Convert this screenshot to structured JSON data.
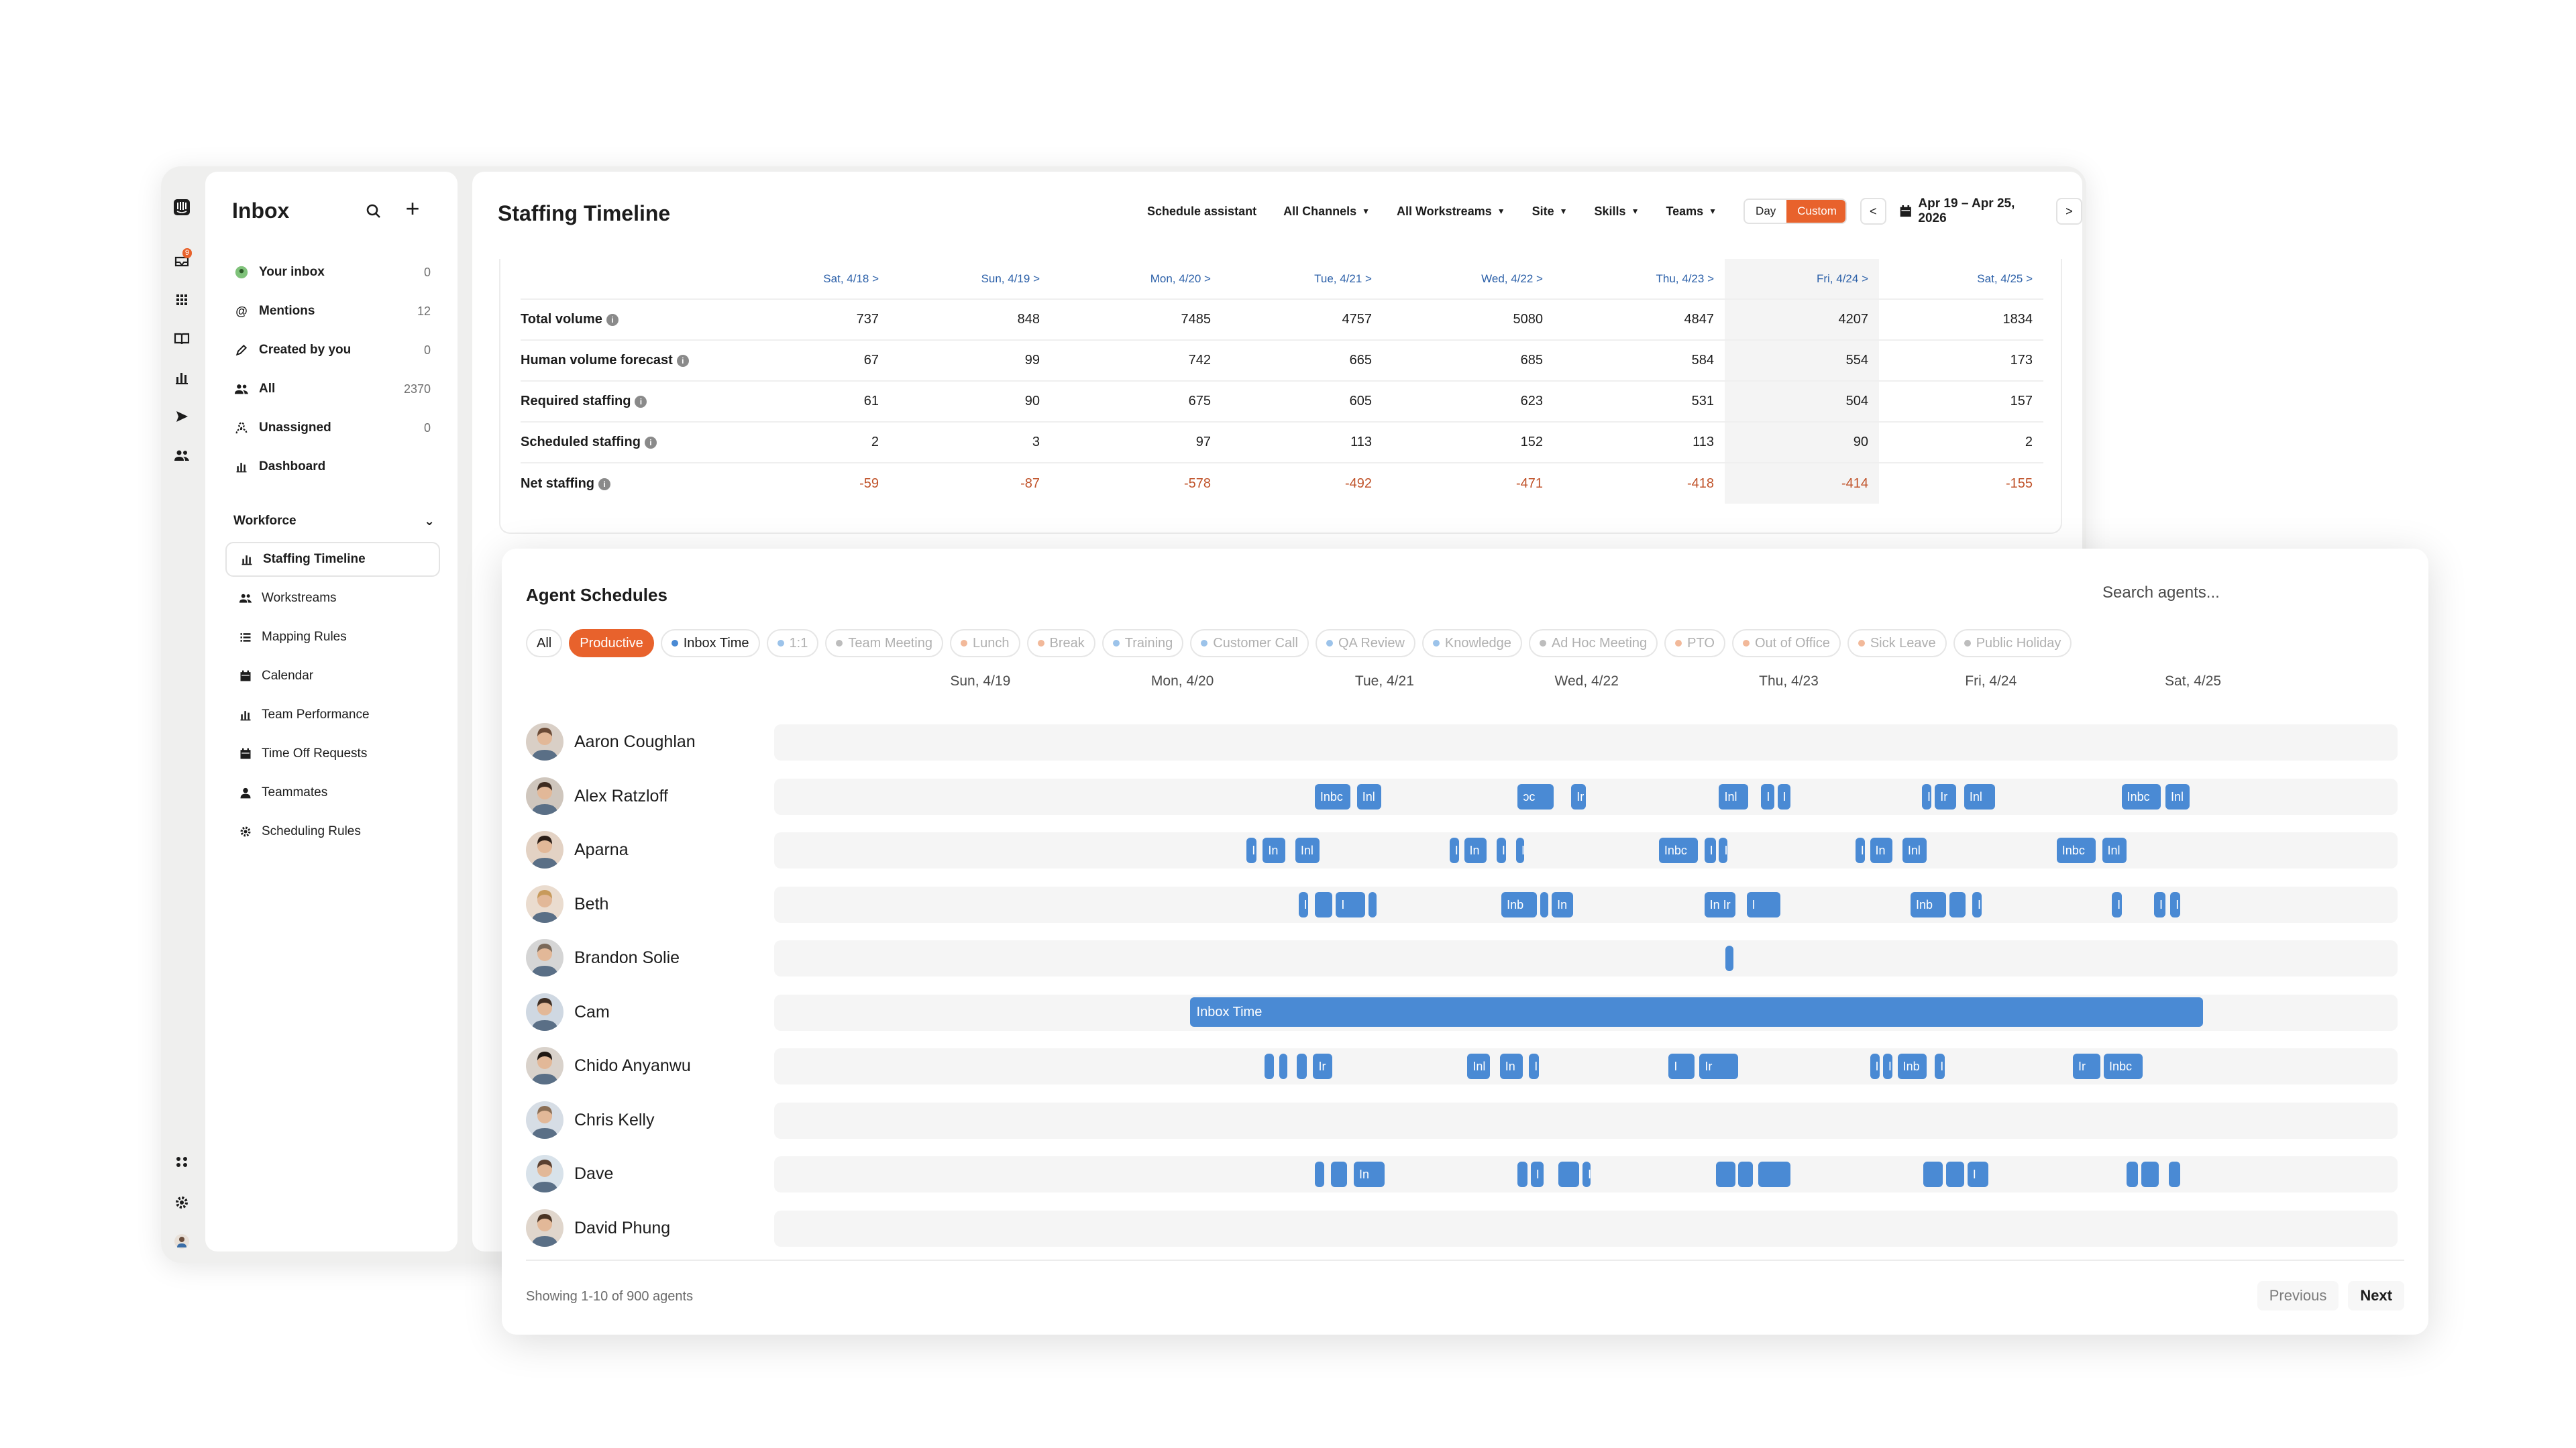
{
  "sidebar": {
    "title": "Inbox",
    "badge": "9",
    "items": [
      {
        "label": "Your inbox",
        "count": "0",
        "icon": "avatar-dot-icon"
      },
      {
        "label": "Mentions",
        "count": "12",
        "icon": "at-icon"
      },
      {
        "label": "Created by you",
        "count": "0",
        "icon": "pencil-icon"
      },
      {
        "label": "All",
        "count": "2370",
        "icon": "people-icon"
      },
      {
        "label": "Unassigned",
        "count": "0",
        "icon": "unassigned-icon"
      },
      {
        "label": "Dashboard",
        "count": "",
        "icon": "bar-chart-icon"
      }
    ],
    "section": "Workforce",
    "workforce": [
      {
        "label": "Staffing Timeline",
        "icon": "bar-chart-icon"
      },
      {
        "label": "Workstreams",
        "icon": "people-icon"
      },
      {
        "label": "Mapping Rules",
        "icon": "list-icon"
      },
      {
        "label": "Calendar",
        "icon": "calendar-icon"
      },
      {
        "label": "Team Performance",
        "icon": "bar-chart-icon"
      },
      {
        "label": "Time Off Requests",
        "icon": "calendar-icon"
      },
      {
        "label": "Teammates",
        "icon": "person-icon"
      },
      {
        "label": "Scheduling Rules",
        "icon": "gear-icon"
      }
    ]
  },
  "header": {
    "title": "Staffing Timeline",
    "schedule_assistant": "Schedule assistant",
    "channels": "All Channels",
    "workstreams": "All Workstreams",
    "site": "Site",
    "skills": "Skills",
    "teams": "Teams",
    "day": "Day",
    "custom": "Custom",
    "prev": "<",
    "next": ">",
    "date_range": "Apr 19 – Apr 25, 2026"
  },
  "metrics": {
    "columns": [
      "Sat, 4/18 >",
      "Sun, 4/19 >",
      "Mon, 4/20 >",
      "Tue, 4/21 >",
      "Wed, 4/22 >",
      "Thu, 4/23 >",
      "Fri, 4/24 >",
      "Sat, 4/25 >"
    ],
    "rows": [
      {
        "label": "Total volume",
        "values": [
          "737",
          "848",
          "7485",
          "4757",
          "5080",
          "4847",
          "4207",
          "1834"
        ]
      },
      {
        "label": "Human volume forecast",
        "values": [
          "67",
          "99",
          "742",
          "665",
          "685",
          "584",
          "554",
          "173"
        ]
      },
      {
        "label": "Required staffing",
        "values": [
          "61",
          "90",
          "675",
          "605",
          "623",
          "531",
          "504",
          "157"
        ]
      },
      {
        "label": "Scheduled staffing",
        "values": [
          "2",
          "3",
          "97",
          "113",
          "152",
          "113",
          "90",
          "2"
        ]
      },
      {
        "label": "Net staffing",
        "values": [
          "-59",
          "-87",
          "-578",
          "-492",
          "-471",
          "-418",
          "-414",
          "-155"
        ]
      }
    ]
  },
  "schedules": {
    "title": "Agent Schedules",
    "search_placeholder": "Search agents...",
    "filters": [
      {
        "label": "All",
        "type": "all"
      },
      {
        "label": "Productive",
        "type": "productive"
      },
      {
        "label": "Inbox Time",
        "type": "inbox",
        "dot": "#4a8ad4"
      },
      {
        "label": "1:1",
        "dot": "#9cc3ea"
      },
      {
        "label": "Team Meeting",
        "dot": "#bdbdbd"
      },
      {
        "label": "Lunch",
        "dot": "#f2b99a"
      },
      {
        "label": "Break",
        "dot": "#f2b99a"
      },
      {
        "label": "Training",
        "dot": "#9cc3ea"
      },
      {
        "label": "Customer Call",
        "dot": "#9cc3ea"
      },
      {
        "label": "QA Review",
        "dot": "#9cc3ea"
      },
      {
        "label": "Knowledge",
        "dot": "#9cc3ea"
      },
      {
        "label": "Ad Hoc Meeting",
        "dot": "#bdbdbd"
      },
      {
        "label": "PTO",
        "dot": "#f2b99a"
      },
      {
        "label": "Out of Office",
        "dot": "#f2b99a"
      },
      {
        "label": "Sick Leave",
        "dot": "#f2b99a"
      },
      {
        "label": "Public Holiday",
        "dot": "#bdbdbd"
      }
    ],
    "days": [
      "Sun, 4/19",
      "Mon, 4/20",
      "Tue, 4/21",
      "Wed, 4/22",
      "Thu, 4/23",
      "Fri, 4/24",
      "Sat, 4/25"
    ],
    "agents": [
      {
        "name": "Aaron Coughlan",
        "blocks": []
      },
      {
        "name": "Alex Ratzloff",
        "blocks": [
          [
            "Inbc",
            0.333,
            0.355
          ],
          [
            "Inl",
            0.359,
            0.374
          ],
          [
            "ɔc",
            0.458,
            0.48
          ],
          [
            "Ir",
            0.491,
            0.5
          ],
          [
            "Inl",
            0.582,
            0.6
          ],
          [
            "I",
            0.608,
            0.616
          ],
          [
            "I",
            0.618,
            0.626
          ],
          [
            "I",
            0.707,
            0.713
          ],
          [
            "Ir",
            0.715,
            0.728
          ],
          [
            "Inl",
            0.733,
            0.752
          ],
          [
            "Inbc",
            0.83,
            0.854
          ],
          [
            "Inl",
            0.857,
            0.872
          ]
        ]
      },
      {
        "name": "Aparna",
        "blocks": [
          [
            "I",
            0.291,
            0.297
          ],
          [
            "In",
            0.301,
            0.315
          ],
          [
            "Inl",
            0.321,
            0.336
          ],
          [
            "I",
            0.416,
            0.422
          ],
          [
            "In",
            0.425,
            0.439
          ],
          [
            "I",
            0.445,
            0.451
          ],
          [
            "I",
            0.457,
            0.461
          ],
          [
            "Inbc",
            0.545,
            0.569
          ],
          [
            "I",
            0.573,
            0.58
          ],
          [
            "I",
            0.582,
            0.587
          ],
          [
            "I",
            0.666,
            0.672
          ],
          [
            "In",
            0.675,
            0.689
          ],
          [
            "Inl",
            0.695,
            0.71
          ],
          [
            "Inbc",
            0.79,
            0.814
          ],
          [
            "Inl",
            0.818,
            0.833
          ]
        ]
      },
      {
        "name": "Beth",
        "blocks": [
          [
            "I",
            0.323,
            0.329
          ],
          [
            "",
            0.333,
            0.344
          ],
          [
            "I",
            0.346,
            0.364
          ],
          [
            "",
            0.366,
            0.37
          ],
          [
            "Inb",
            0.448,
            0.47
          ],
          [
            "",
            0.472,
            0.477
          ],
          [
            "In",
            0.479,
            0.492
          ],
          [
            "In Ir",
            0.573,
            0.592
          ],
          [
            "I",
            0.599,
            0.62
          ],
          [
            "Inb",
            0.7,
            0.722
          ],
          [
            "",
            0.724,
            0.734
          ],
          [
            "I",
            0.738,
            0.744
          ],
          [
            "I",
            0.824,
            0.83
          ],
          [
            "I",
            0.85,
            0.857
          ],
          [
            "I",
            0.86,
            0.866
          ]
        ]
      },
      {
        "name": "Brandon Solie",
        "blocks": [
          [
            "",
            0.586,
            0.591
          ]
        ]
      },
      {
        "name": "Cam",
        "blocks": [
          [
            "Inbox Time",
            0.256,
            0.88,
            "full"
          ]
        ]
      },
      {
        "name": "Chido Anyanwu",
        "blocks": [
          [
            "",
            0.302,
            0.308
          ],
          [
            "",
            0.311,
            0.316
          ],
          [
            "",
            0.322,
            0.328
          ],
          [
            "Ir",
            0.332,
            0.344
          ],
          [
            "Inl",
            0.427,
            0.441
          ],
          [
            "In",
            0.447,
            0.461
          ],
          [
            "I",
            0.465,
            0.471
          ],
          [
            "I",
            0.551,
            0.567
          ],
          [
            "Ir",
            0.57,
            0.594
          ],
          [
            "I",
            0.675,
            0.681
          ],
          [
            "I",
            0.683,
            0.689
          ],
          [
            "Inb",
            0.692,
            0.71
          ],
          [
            "I",
            0.715,
            0.721
          ],
          [
            "Ir",
            0.8,
            0.817
          ],
          [
            "Inbc",
            0.819,
            0.843
          ]
        ]
      },
      {
        "name": "Chris Kelly",
        "blocks": []
      },
      {
        "name": "Dave",
        "blocks": [
          [
            "",
            0.333,
            0.339
          ],
          [
            "",
            0.343,
            0.353
          ],
          [
            "In",
            0.357,
            0.376
          ],
          [
            "",
            0.458,
            0.464
          ],
          [
            "I",
            0.466,
            0.474
          ],
          [
            "",
            0.483,
            0.496
          ],
          [
            "I",
            0.498,
            0.502
          ],
          [
            "",
            0.58,
            0.592
          ],
          [
            "",
            0.594,
            0.603
          ],
          [
            "",
            0.606,
            0.626
          ],
          [
            "",
            0.708,
            0.72
          ],
          [
            "",
            0.722,
            0.733
          ],
          [
            "I",
            0.735,
            0.748
          ],
          [
            "",
            0.833,
            0.84
          ],
          [
            "",
            0.842,
            0.853
          ],
          [
            "",
            0.859,
            0.866
          ]
        ]
      },
      {
        "name": "David Phung",
        "blocks": []
      }
    ],
    "showing": "Showing 1-10 of 900 agents",
    "previous": "Previous",
    "next": "Next"
  }
}
